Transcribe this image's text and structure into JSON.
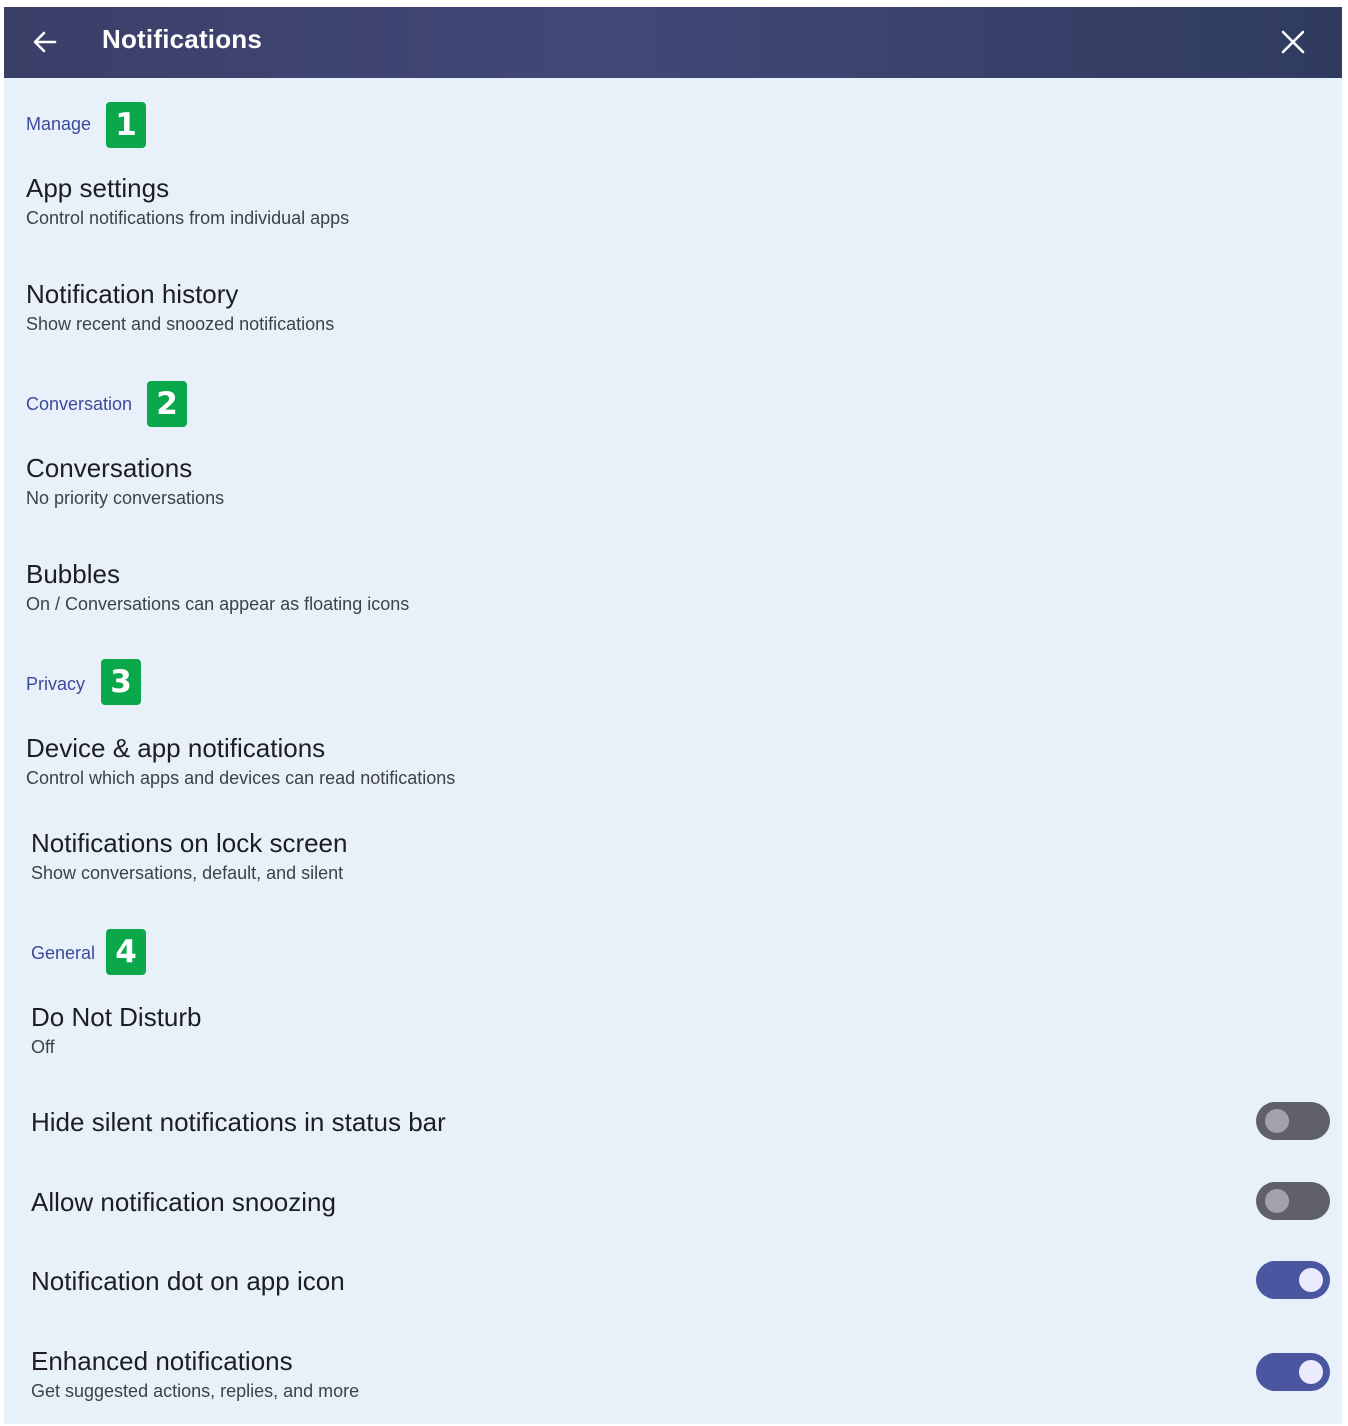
{
  "header": {
    "title": "Notifications",
    "back_icon": "arrow-left-icon",
    "close_icon": "close-icon"
  },
  "colors": {
    "header_bg": "#3a3f68",
    "page_bg": "#e8f1fa",
    "section_label": "#3c4a9c",
    "badge": "#0aa84b",
    "toggle_on": "#4a56a0",
    "toggle_off": "#5f6068"
  },
  "sections": [
    {
      "label": "Manage",
      "badge": "1",
      "items": [
        {
          "title": "App settings",
          "subtitle": "Control notifications from individual apps"
        },
        {
          "title": "Notification history",
          "subtitle": "Show recent and snoozed notifications"
        }
      ]
    },
    {
      "label": "Conversation",
      "badge": "2",
      "items": [
        {
          "title": "Conversations",
          "subtitle": "No priority conversations"
        },
        {
          "title": "Bubbles",
          "subtitle": "On / Conversations can appear as floating icons"
        }
      ]
    },
    {
      "label": "Privacy",
      "badge": "3",
      "items": [
        {
          "title": "Device & app notifications",
          "subtitle": "Control which apps and devices can read notifications"
        },
        {
          "title": "Notifications on lock screen",
          "subtitle": "Show conversations, default, and silent"
        }
      ]
    },
    {
      "label": "General",
      "badge": "4",
      "items": [
        {
          "title": "Do Not Disturb",
          "subtitle": "Off"
        },
        {
          "title": "Hide silent notifications in status bar",
          "toggle": false
        },
        {
          "title": "Allow notification snoozing",
          "toggle": false
        },
        {
          "title": "Notification dot on app icon",
          "toggle": true
        },
        {
          "title": "Enhanced notifications",
          "subtitle": "Get suggested actions, replies, and more",
          "toggle": true
        }
      ]
    }
  ]
}
